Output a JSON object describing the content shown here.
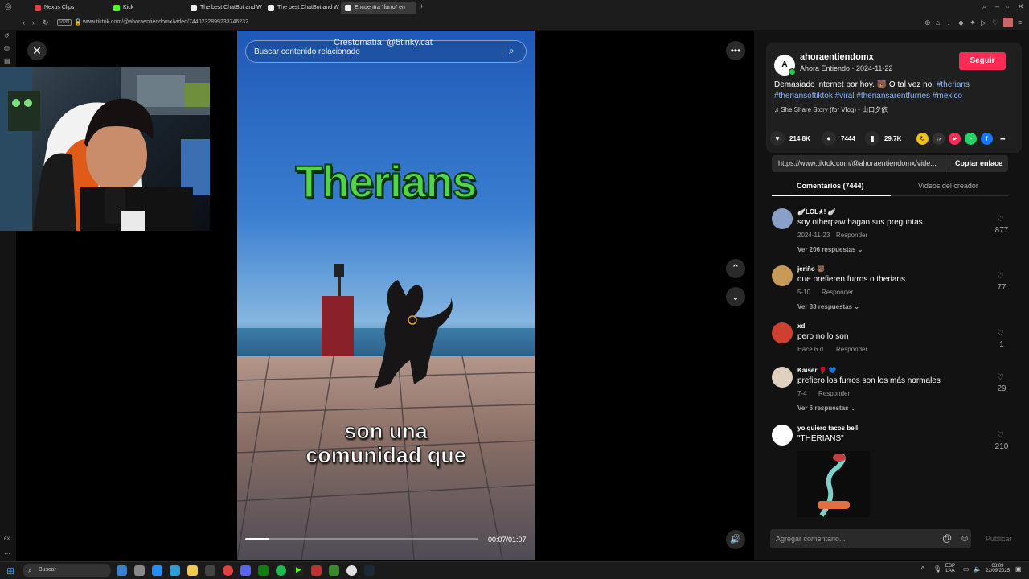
{
  "browser": {
    "tabs": [
      {
        "label": "Nexus Clips",
        "color": "#e04040"
      },
      {
        "label": "Kick",
        "color": "#53fc18"
      },
      {
        "label": "The best ChatBot and W",
        "color": "#ffffff"
      },
      {
        "label": "The best ChatBot and W",
        "color": "#ffffff"
      },
      {
        "label": "Encuentra \"furro\" en",
        "color": "#ffffff"
      }
    ],
    "url": "www.tiktok.com/@ahoraentiendomx/video/7440232899233746232",
    "vpn_label": "VPN"
  },
  "video": {
    "search_placeholder": "Buscar contenido relacionado",
    "watermark": "Crestomatía: @5tinky.cat",
    "headline": "Therians",
    "subtitle_line1": "son una",
    "subtitle_line2": "comunidad que",
    "time": "00:07/01:07",
    "progress": 0.105
  },
  "creator": {
    "username": "ahoraentiendomx",
    "meta": "Ahora Entiendo · 2024-11-22",
    "avatar_text": "A",
    "follow_label": "Seguir",
    "description": "Demasiado internet por hoy. 🐻 O tal vez no.",
    "hashtags": [
      "#therians",
      "#theriansoftiktok",
      "#viral",
      "#theriansarentfurries",
      "#mexico"
    ],
    "music": "♫  She Share Story (for Vlog) - 山口夕依"
  },
  "stats": {
    "likes": "214.8K",
    "comments": "7444",
    "saves": "29.7K"
  },
  "share": {
    "link": "https://www.tiktok.com/@ahoraentiendomx/vide...",
    "copy_label": "Copiar enlace"
  },
  "panel_tabs": {
    "comments": "Comentarios (7444)",
    "creator_videos": "Videos del creador"
  },
  "comments": [
    {
      "user": "🪽LOL✮! 🪽",
      "text": "soy otherpaw hagan sus preguntas",
      "date": "2024-11-23",
      "reply": "Responder",
      "more": "Ver 206 respuestas ⌄",
      "likes": "877",
      "color": "#8aa0c8"
    },
    {
      "user": "jeriño 🐻",
      "text": "que prefieren furros o therians",
      "date": "5-10",
      "reply": "Responder",
      "more": "Ver 83 respuestas ⌄",
      "likes": "77",
      "color": "#c89a5a"
    },
    {
      "user": "xd",
      "text": "pero no lo son",
      "date": "Hace 6 d",
      "reply": "Responder",
      "more": "",
      "likes": "1",
      "color": "#d04030"
    },
    {
      "user": "Kaiser 🌹 💙",
      "text": "prefiero los furros son los más normales",
      "date": "7-4",
      "reply": "Responder",
      "more": "Ver 6 respuestas ⌄",
      "likes": "29",
      "color": "#e0d0c0"
    },
    {
      "user": "yo quiero tacos bell",
      "text": "\"THERIANS\"",
      "date": "",
      "reply": "",
      "more": "",
      "likes": "210",
      "color": "#ffffff"
    }
  ],
  "comment_input": {
    "placeholder": "Agregar comentario...",
    "publish_label": "Publicar"
  },
  "taskbar": {
    "search": "Buscar",
    "lang_line1": "ESP",
    "lang_line2": "LAA",
    "time": "03:09",
    "date": "22/09/2025"
  },
  "sidebar": {
    "zoom_label": "6X"
  }
}
